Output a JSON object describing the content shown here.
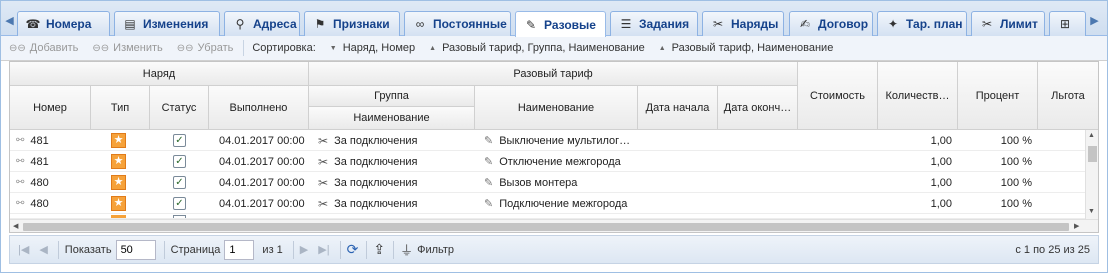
{
  "tabs": [
    {
      "label": "Номера",
      "icon": "phone-icon",
      "glyph": "☎"
    },
    {
      "label": "Изменения",
      "icon": "list-icon",
      "glyph": "▤"
    },
    {
      "label": "Адреса",
      "icon": "location-pin-icon",
      "glyph": "⚲"
    },
    {
      "label": "Признаки",
      "icon": "tags-icon",
      "glyph": "⚑"
    },
    {
      "label": "Постоянные",
      "icon": "link-icon",
      "glyph": "∞"
    },
    {
      "label": "Разовые",
      "icon": "wrench-icon",
      "glyph": "✎"
    },
    {
      "label": "Задания",
      "icon": "tasks-icon",
      "glyph": "☰"
    },
    {
      "label": "Наряды",
      "icon": "tools-icon",
      "glyph": "✂"
    },
    {
      "label": "Договор",
      "icon": "contract-icon",
      "glyph": "✍"
    },
    {
      "label": "Тар. план",
      "icon": "tariff-plan-icon",
      "glyph": "✦"
    },
    {
      "label": "Лимит",
      "icon": "scissors-icon",
      "glyph": "✂"
    },
    {
      "label": "",
      "icon": "calculator-icon",
      "glyph": "⊞"
    }
  ],
  "active_tab": "Разовые",
  "toolbar": {
    "add": "Добавить",
    "edit": "Изменить",
    "remove": "Убрать",
    "sort_label": "Сортировка:",
    "sorts": [
      "Наряд, Номер",
      "Разовый тариф, Группа, Наименование",
      "Разовый тариф, Наименование"
    ]
  },
  "grid": {
    "group_order": "Наряд",
    "group_tariff": "Разовый тариф",
    "group_group": "Группа",
    "cols": {
      "number": "Номер",
      "type": "Тип",
      "status": "Статус",
      "done": "Выполнено",
      "name_sub": "Наименование",
      "name": "Наименование",
      "start": "Дата начала",
      "end": "Дата оконч…",
      "cost": "Стоимость",
      "qty": "Количеств…",
      "percent": "Процент",
      "benefit": "Льгота"
    },
    "rows": [
      {
        "number": "481",
        "done": "04.01.2017 00:00",
        "group": "За подключения",
        "name": "Выключение мультилог…",
        "qty": "1,00",
        "percent": "100 %"
      },
      {
        "number": "481",
        "done": "04.01.2017 00:00",
        "group": "За подключения",
        "name": "Отключение межгорода",
        "qty": "1,00",
        "percent": "100 %"
      },
      {
        "number": "480",
        "done": "04.01.2017 00:00",
        "group": "За подключения",
        "name": "Вызов монтера",
        "qty": "1,00",
        "percent": "100 %"
      },
      {
        "number": "480",
        "done": "04.01.2017 00:00",
        "group": "За подключения",
        "name": "Подключение межгорода",
        "qty": "1,00",
        "percent": "100 %"
      }
    ]
  },
  "pager": {
    "show_label": "Показать",
    "page_size": "50",
    "page_label": "Страница",
    "page": "1",
    "of": "из 1",
    "filter": "Фильтр",
    "summary": "с 1 по 25 из 25"
  }
}
